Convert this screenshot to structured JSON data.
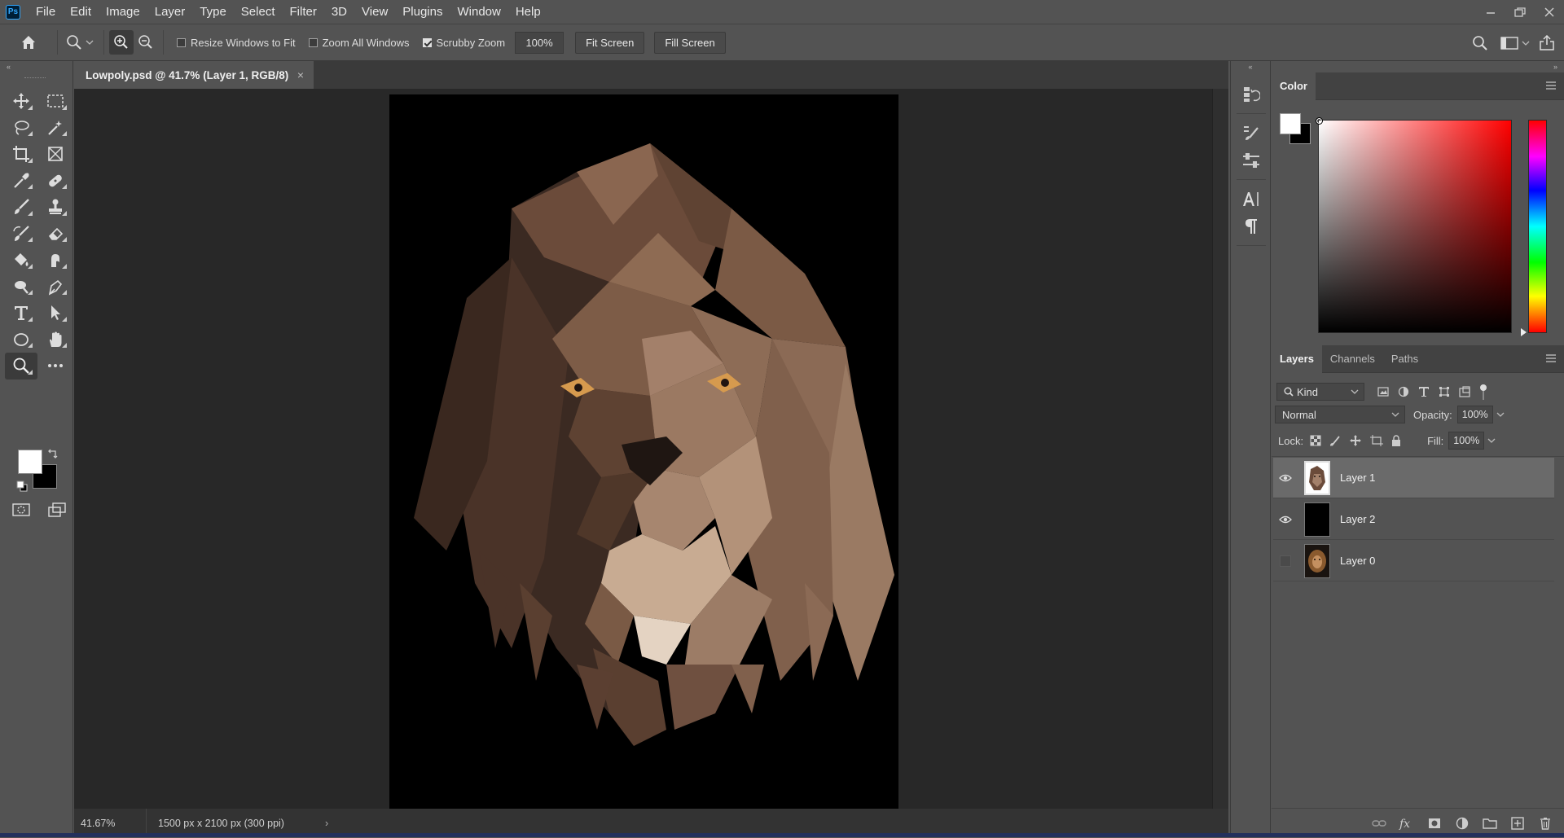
{
  "app": {
    "logo": "Ps",
    "accent": "#31a8ff",
    "theme_bg": "#535353"
  },
  "menu": [
    "File",
    "Edit",
    "Image",
    "Layer",
    "Type",
    "Select",
    "Filter",
    "3D",
    "View",
    "Plugins",
    "Window",
    "Help"
  ],
  "options": {
    "resize_windows": "Resize Windows to Fit",
    "resize_checked": false,
    "zoom_all": "Zoom All Windows",
    "zoom_all_checked": false,
    "scrubby": "Scrubby Zoom",
    "scrubby_checked": true,
    "zoom_value": "100%",
    "fit_screen": "Fit Screen",
    "fill_screen": "Fill Screen"
  },
  "document": {
    "tab_title": "Lowpoly.psd @ 41.7% (Layer 1, RGB/8)",
    "close": "×",
    "status_zoom": "41.67%",
    "status_info": "1500 px x 2100 px (300 ppi)",
    "status_arrow": "›"
  },
  "tools": [
    "move-tool-icon",
    "marquee-tool-icon",
    "lasso-tool-icon",
    "magic-wand-tool-icon",
    "crop-tool-icon",
    "frame-tool-icon",
    "eyedropper-tool-icon",
    "healing-brush-tool-icon",
    "brush-tool-icon",
    "clone-stamp-tool-icon",
    "history-brush-tool-icon",
    "eraser-tool-icon",
    "paint-bucket-tool-icon",
    "smudge-tool-icon",
    "dodge-tool-icon",
    "pen-tool-icon",
    "type-tool-icon",
    "path-selection-tool-icon",
    "ellipse-tool-icon",
    "hand-tool-icon",
    "zoom-tool-icon",
    "more-tools-icon"
  ],
  "colors": {
    "foreground": "#ffffff",
    "background": "#000000"
  },
  "color_panel": {
    "title": "Color"
  },
  "layers_panel": {
    "tabs": [
      "Layers",
      "Channels",
      "Paths"
    ],
    "active_tab": "Layers",
    "filter_kind": "Kind",
    "blend_mode": "Normal",
    "opacity_label": "Opacity:",
    "opacity_value": "100%",
    "lock_label": "Lock:",
    "fill_label": "Fill:",
    "fill_value": "100%",
    "layers": [
      {
        "name": "Layer 1",
        "visible": true,
        "selected": true
      },
      {
        "name": "Layer 2",
        "visible": true,
        "selected": false
      },
      {
        "name": "Layer 0",
        "visible": false,
        "selected": false
      }
    ]
  }
}
